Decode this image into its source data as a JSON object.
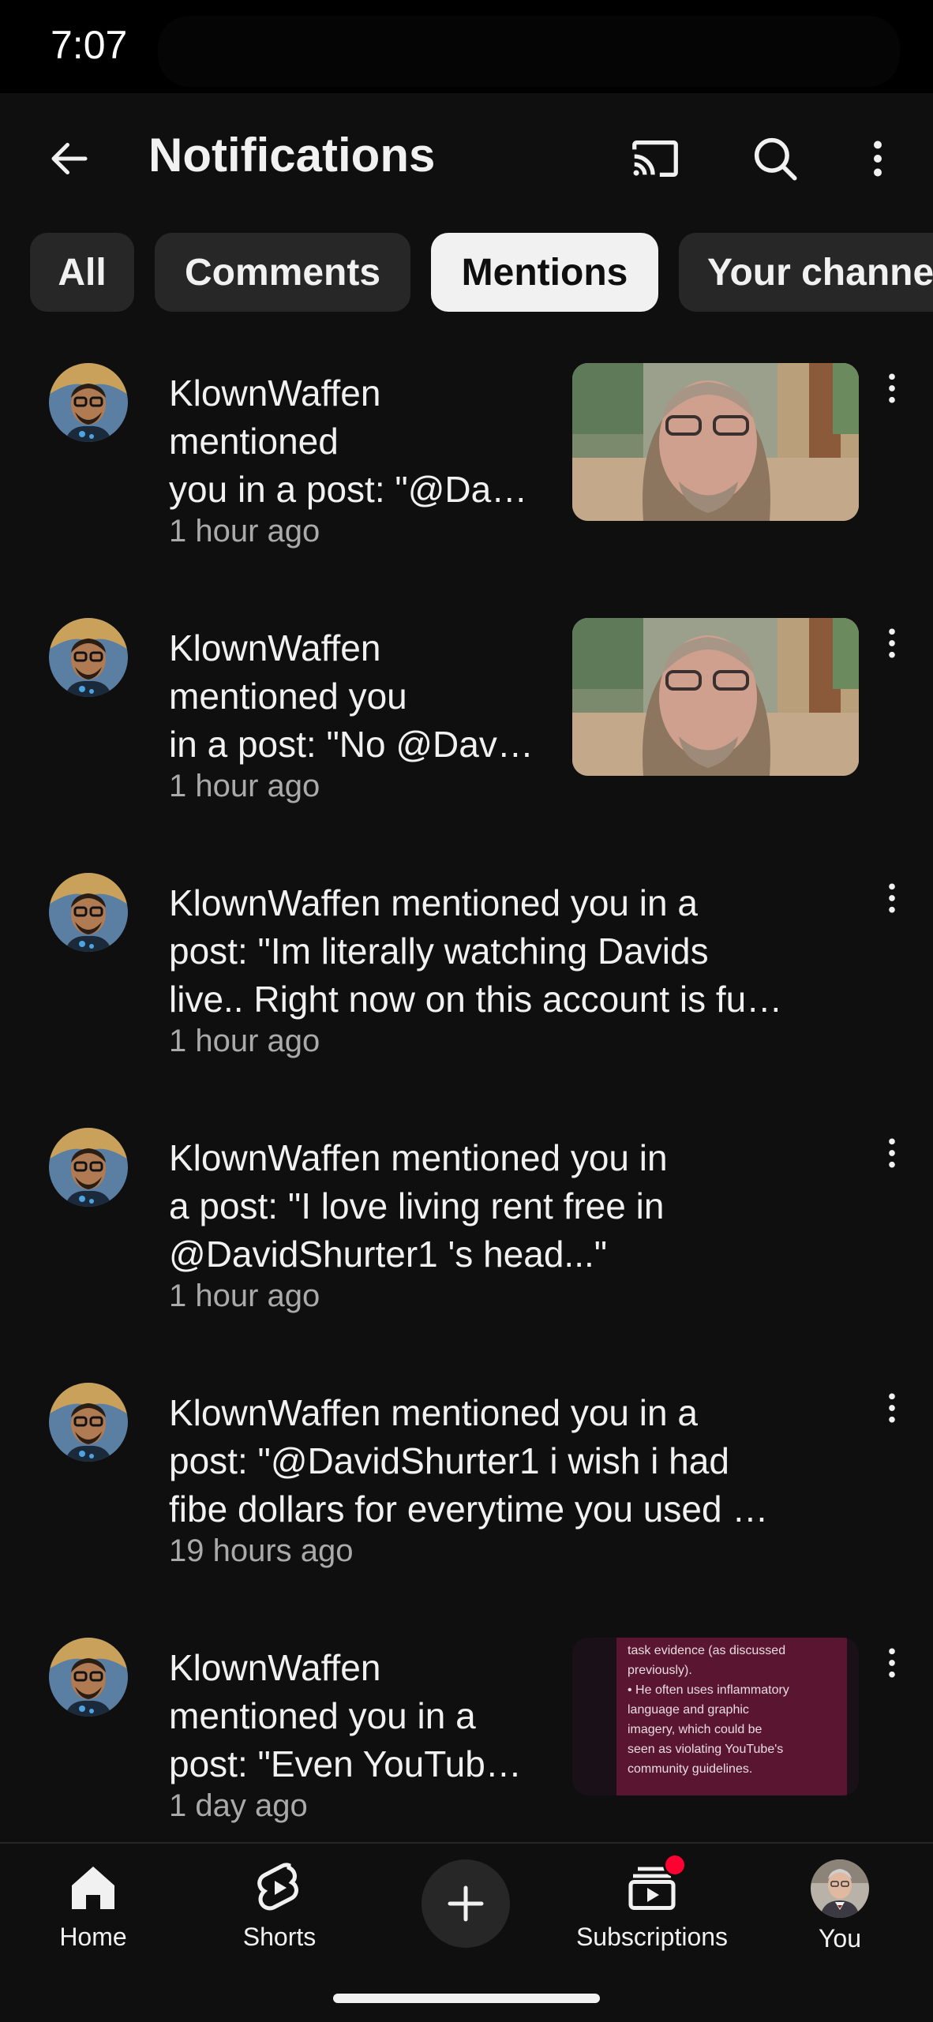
{
  "status_bar": {
    "time": "7:07"
  },
  "header": {
    "title": "Notifications"
  },
  "chips": [
    {
      "label": "All",
      "active": false
    },
    {
      "label": "Comments",
      "active": false
    },
    {
      "label": "Mentions",
      "active": true
    },
    {
      "label": "Your channe",
      "active": false
    }
  ],
  "notifications": [
    {
      "lines": [
        "KlownWaffen",
        "mentioned",
        "you in a post: \"@Da…"
      ],
      "time": "1 hour ago",
      "thumbnail": "face-video"
    },
    {
      "lines": [
        "KlownWaffen",
        "mentioned you",
        "in a post: \"No @Dav…"
      ],
      "time": "1 hour ago",
      "thumbnail": "face-video"
    },
    {
      "lines": [
        "KlownWaffen mentioned you in a",
        "post: \"Im literally watching Davids",
        "live.. Right now on this account is fu…"
      ],
      "time": "1 hour ago",
      "thumbnail": ""
    },
    {
      "lines": [
        "KlownWaffen mentioned you in",
        "a post: \"I love living rent free in",
        "@DavidShurter1 's head...\""
      ],
      "time": "1 hour ago",
      "thumbnail": ""
    },
    {
      "lines": [
        "KlownWaffen mentioned you in a",
        "post: \"@DavidShurter1 i wish i had",
        "fibe dollars for everytime you used …"
      ],
      "time": "19 hours ago",
      "thumbnail": ""
    },
    {
      "lines": [
        "KlownWaffen",
        "mentioned you in a",
        "post: \"Even YouTub…"
      ],
      "time": "1 day ago",
      "thumbnail": "text-slide",
      "thumb_text": [
        "task evidence (as discussed",
        "previously).",
        "• He often uses inflammatory",
        "language and graphic",
        "imagery, which could be",
        "seen as violating YouTube's",
        "community guidelines."
      ]
    }
  ],
  "bottom_nav": {
    "home": "Home",
    "shorts": "Shorts",
    "subscriptions": "Subscriptions",
    "you": "You"
  },
  "colors": {
    "background": "#0f0f0f",
    "chip": "#272727",
    "chip_active": "#f1f1f1",
    "secondary_text": "#aaaaaa",
    "badge": "#ff0033"
  }
}
